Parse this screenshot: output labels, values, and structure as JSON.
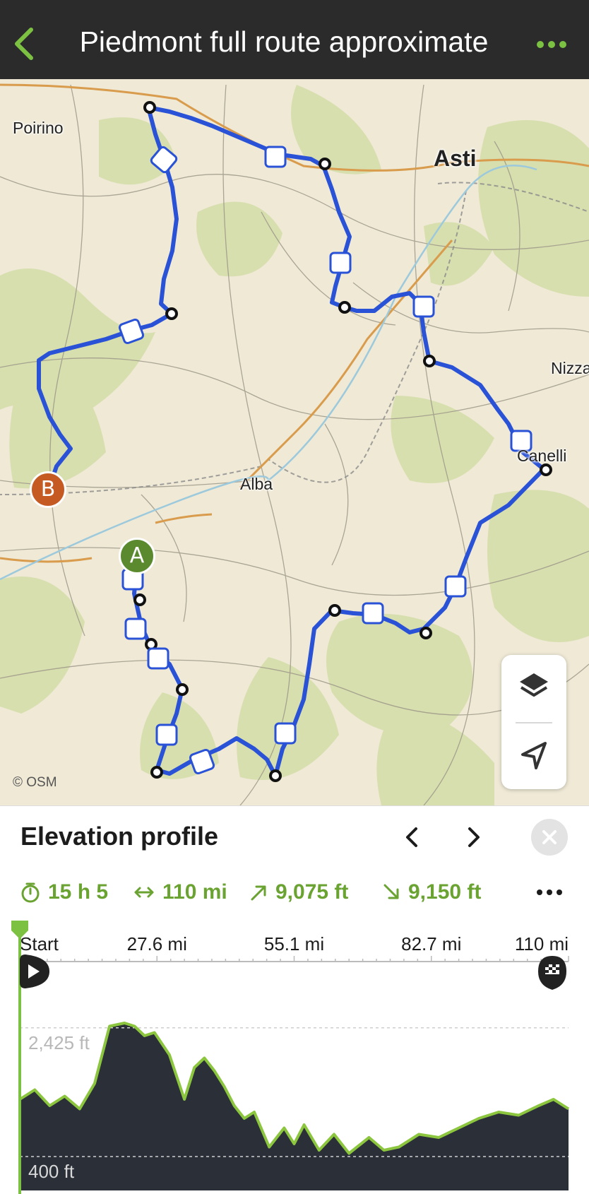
{
  "header": {
    "title": "Piedmont full route approximate",
    "back_icon": "chevron-left-icon",
    "more_icon": "more-horizontal-icon"
  },
  "map": {
    "places": {
      "poirino": "Poirino",
      "asti": "Asti",
      "nizza": "Nizza",
      "canelli": "Canelli",
      "alba": "Alba"
    },
    "start_marker": "A",
    "end_marker": "B",
    "attribution": "© OSM",
    "controls": {
      "layers_icon": "layers-icon",
      "locate_icon": "navigation-arrow-icon"
    },
    "colors": {
      "route": "#2a52d6",
      "start": "#5b8a2e",
      "end": "#c65a23",
      "terrain_base": "#efe9d6",
      "forest": "#d7dfae"
    }
  },
  "elevation": {
    "title": "Elevation profile",
    "stats": {
      "duration": "15 h 5",
      "distance": "110 mi",
      "ascent": "9,075 ft",
      "descent": "9,150 ft"
    },
    "accent_color": "#6aa332"
  },
  "chart_data": {
    "type": "area",
    "title": "Elevation profile",
    "x_ticks": [
      "Start",
      "27.6 mi",
      "55.1 mi",
      "82.7 mi",
      "110 mi"
    ],
    "y_ticks": [
      "2,425 ft",
      "400 ft"
    ],
    "xlim": [
      0,
      110
    ],
    "ylim": [
      0,
      2800
    ],
    "x": [
      0,
      3,
      6,
      9,
      12,
      15,
      18,
      21,
      23,
      25,
      27,
      30,
      33,
      35,
      37,
      39,
      41,
      43,
      45,
      47,
      50,
      53,
      55,
      57,
      60,
      63,
      66,
      70,
      73,
      76,
      80,
      84,
      88,
      92,
      96,
      100,
      104,
      107,
      110
    ],
    "y": [
      1300,
      1450,
      1200,
      1350,
      1150,
      1550,
      2450,
      2500,
      2450,
      2300,
      2350,
      2000,
      1300,
      1800,
      1950,
      1750,
      1500,
      1200,
      1000,
      1100,
      550,
      850,
      600,
      900,
      500,
      750,
      450,
      700,
      500,
      550,
      750,
      700,
      850,
      1000,
      1100,
      1050,
      1200,
      1300,
      1150
    ],
    "grid": "dashed at labelled ticks",
    "colors": {
      "fill": "#2a2f38",
      "line": "#8cc63f",
      "steep": "#d0703a"
    }
  }
}
